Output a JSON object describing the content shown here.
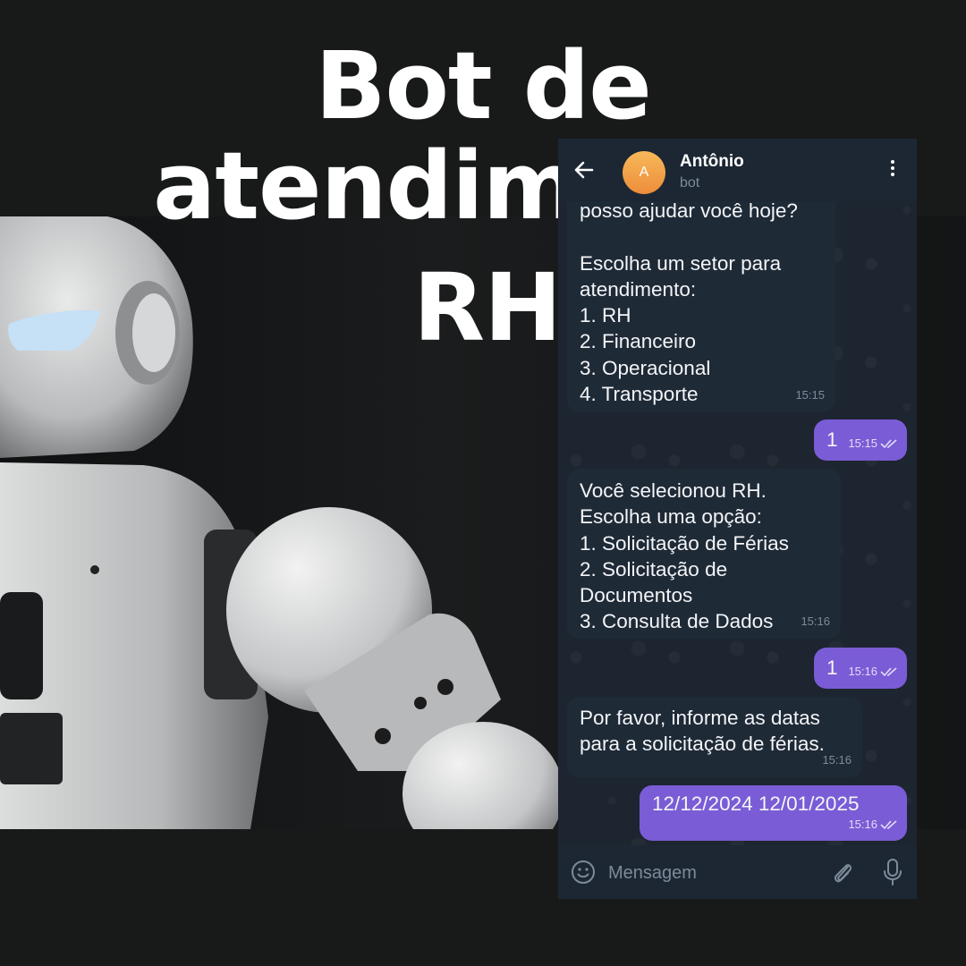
{
  "poster": {
    "title_line1": "Bot de atendimento",
    "title_line2": "RH"
  },
  "chat": {
    "contact_name": "Antônio",
    "contact_initial": "A",
    "contact_status": "bot",
    "input_placeholder": "Mensagem",
    "colors": {
      "incoming_bubble": "#1f2a37",
      "outgoing_bubble": "#7a5cd6",
      "header": "#1c2733",
      "avatar": "#f0a04b"
    },
    "messages": [
      {
        "direction": "in",
        "text": "posso ajudar você hoje?\n\nEscolha um setor para\natendimento:\n1. RH\n2. Financeiro\n3. Operacional\n4. Transporte",
        "time": "15:15"
      },
      {
        "direction": "out",
        "text": "1",
        "time": "15:15"
      },
      {
        "direction": "in",
        "text": "Você selecionou RH.\nEscolha uma opção:\n1. Solicitação de Férias\n2. Solicitação de\nDocumentos\n3. Consulta de Dados",
        "time": "15:16"
      },
      {
        "direction": "out",
        "text": "1",
        "time": "15:16"
      },
      {
        "direction": "in",
        "text": "Por favor, informe as datas\npara a solicitação de férias.",
        "time": "15:16"
      },
      {
        "direction": "out",
        "text": "12/12/2024 12/01/2025",
        "time": "15:16"
      }
    ],
    "icons": [
      "back-arrow-icon",
      "more-vert-icon",
      "emoji-icon",
      "attach-icon",
      "mic-icon",
      "double-check-icon"
    ]
  }
}
